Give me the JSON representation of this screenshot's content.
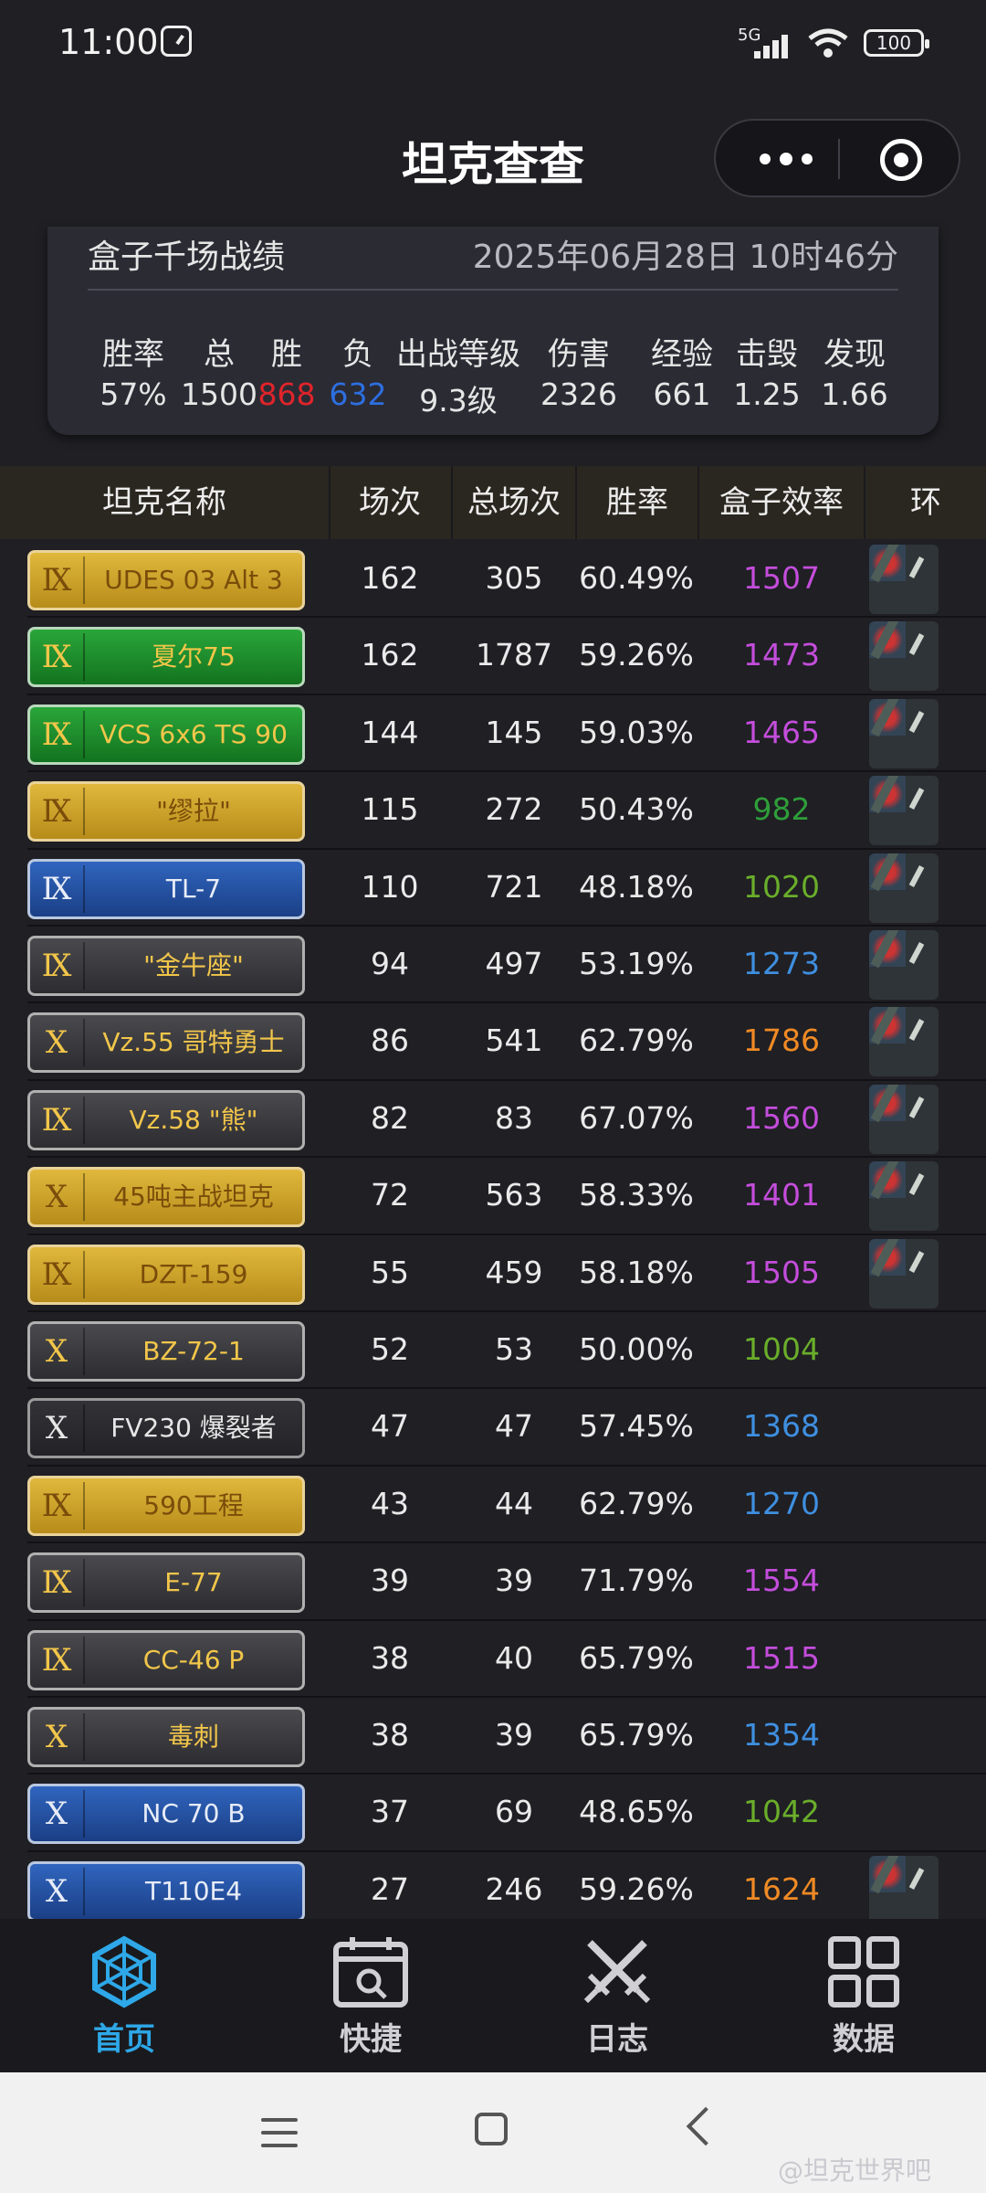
{
  "status_bar": {
    "time": "11:00",
    "network": "5G",
    "battery": "100"
  },
  "app": {
    "title": "坦克查查"
  },
  "summary": {
    "title": "盒子千场战绩",
    "date": "2025年06月28日 10时46分",
    "headers": [
      "胜率",
      "总",
      "胜",
      "负",
      "出战等级",
      "伤害",
      "经验",
      "击毁",
      "发现"
    ],
    "values": [
      "57%",
      "1500",
      "868",
      "632",
      "9.3级",
      "2326",
      "661",
      "1.25",
      "1.66"
    ],
    "win_color": "#e0242b",
    "loss_color": "#2d6fe0"
  },
  "table": {
    "columns": [
      "坦克名称",
      "场次",
      "总场次",
      "胜率",
      "盒子效率",
      "环"
    ],
    "rows": [
      {
        "tier": "Ⅸ",
        "name": "UDES 03 Alt 3",
        "badge": "gold",
        "games": "162",
        "total": "305",
        "rate": "60.49%",
        "eff": "1507",
        "eff_color": "#c44ddb",
        "ring": true
      },
      {
        "tier": "Ⅸ",
        "name": "夏尔75",
        "badge": "green",
        "games": "162",
        "total": "1787",
        "rate": "59.26%",
        "eff": "1473",
        "eff_color": "#c44ddb",
        "ring": true
      },
      {
        "tier": "Ⅸ",
        "name": "VCS 6x6 TS 90",
        "badge": "green",
        "games": "144",
        "total": "145",
        "rate": "59.03%",
        "eff": "1465",
        "eff_color": "#c44ddb",
        "ring": true
      },
      {
        "tier": "Ⅸ",
        "name": "\"缪拉\"",
        "badge": "gold",
        "games": "115",
        "total": "272",
        "rate": "50.43%",
        "eff": "982",
        "eff_color": "#2f9e3a",
        "ring": true
      },
      {
        "tier": "Ⅸ",
        "name": "TL-7",
        "badge": "blue",
        "games": "110",
        "total": "721",
        "rate": "48.18%",
        "eff": "1020",
        "eff_color": "#6aae2a",
        "ring": true
      },
      {
        "tier": "Ⅸ",
        "name": "\"金牛座\"",
        "badge": "gray",
        "games": "94",
        "total": "497",
        "rate": "53.19%",
        "eff": "1273",
        "eff_color": "#3f8fe0",
        "ring": true
      },
      {
        "tier": "Ⅹ",
        "name": "Vz.55 哥特勇士",
        "badge": "gray",
        "games": "86",
        "total": "541",
        "rate": "62.79%",
        "eff": "1786",
        "eff_color": "#f08a24",
        "ring": true
      },
      {
        "tier": "Ⅸ",
        "name": "Vz.58 \"熊\"",
        "badge": "gray",
        "games": "82",
        "total": "83",
        "rate": "67.07%",
        "eff": "1560",
        "eff_color": "#c44ddb",
        "ring": true
      },
      {
        "tier": "Ⅹ",
        "name": "45吨主战坦克",
        "badge": "gold",
        "games": "72",
        "total": "563",
        "rate": "58.33%",
        "eff": "1401",
        "eff_color": "#c44ddb",
        "ring": true
      },
      {
        "tier": "Ⅸ",
        "name": "DZT-159",
        "badge": "gold",
        "games": "55",
        "total": "459",
        "rate": "58.18%",
        "eff": "1505",
        "eff_color": "#c44ddb",
        "ring": true
      },
      {
        "tier": "Ⅹ",
        "name": "BZ-72-1",
        "badge": "gray",
        "games": "52",
        "total": "53",
        "rate": "50.00%",
        "eff": "1004",
        "eff_color": "#6aae2a",
        "ring": false
      },
      {
        "tier": "Ⅹ",
        "name": "FV230 爆裂者",
        "badge": "dark",
        "games": "47",
        "total": "47",
        "rate": "57.45%",
        "eff": "1368",
        "eff_color": "#3f8fe0",
        "ring": false
      },
      {
        "tier": "Ⅸ",
        "name": "590工程",
        "badge": "gold",
        "games": "43",
        "total": "44",
        "rate": "62.79%",
        "eff": "1270",
        "eff_color": "#3f8fe0",
        "ring": false
      },
      {
        "tier": "Ⅸ",
        "name": "E-77",
        "badge": "gray",
        "games": "39",
        "total": "39",
        "rate": "71.79%",
        "eff": "1554",
        "eff_color": "#c44ddb",
        "ring": false
      },
      {
        "tier": "Ⅸ",
        "name": "CC-46 P",
        "badge": "gray",
        "games": "38",
        "total": "40",
        "rate": "65.79%",
        "eff": "1515",
        "eff_color": "#c44ddb",
        "ring": false
      },
      {
        "tier": "Ⅹ",
        "name": "毒刺",
        "badge": "gray",
        "games": "38",
        "total": "39",
        "rate": "65.79%",
        "eff": "1354",
        "eff_color": "#3f8fe0",
        "ring": false
      },
      {
        "tier": "Ⅹ",
        "name": "NC 70 B",
        "badge": "blue",
        "games": "37",
        "total": "69",
        "rate": "48.65%",
        "eff": "1042",
        "eff_color": "#6aae2a",
        "ring": false
      },
      {
        "tier": "Ⅹ",
        "name": "T110E4",
        "badge": "blue",
        "games": "27",
        "total": "246",
        "rate": "59.26%",
        "eff": "1624",
        "eff_color": "#f08a24",
        "ring": true
      }
    ]
  },
  "bottom_nav": {
    "items": [
      {
        "label": "首页",
        "icon": "home-web-icon",
        "active": true
      },
      {
        "label": "快捷",
        "icon": "calendar-search-icon",
        "active": false
      },
      {
        "label": "日志",
        "icon": "crossed-swords-icon",
        "active": false
      },
      {
        "label": "数据",
        "icon": "grid-icon",
        "active": false
      }
    ],
    "active_color": "#2ea8e8"
  },
  "watermark": "@坦克世界吧"
}
